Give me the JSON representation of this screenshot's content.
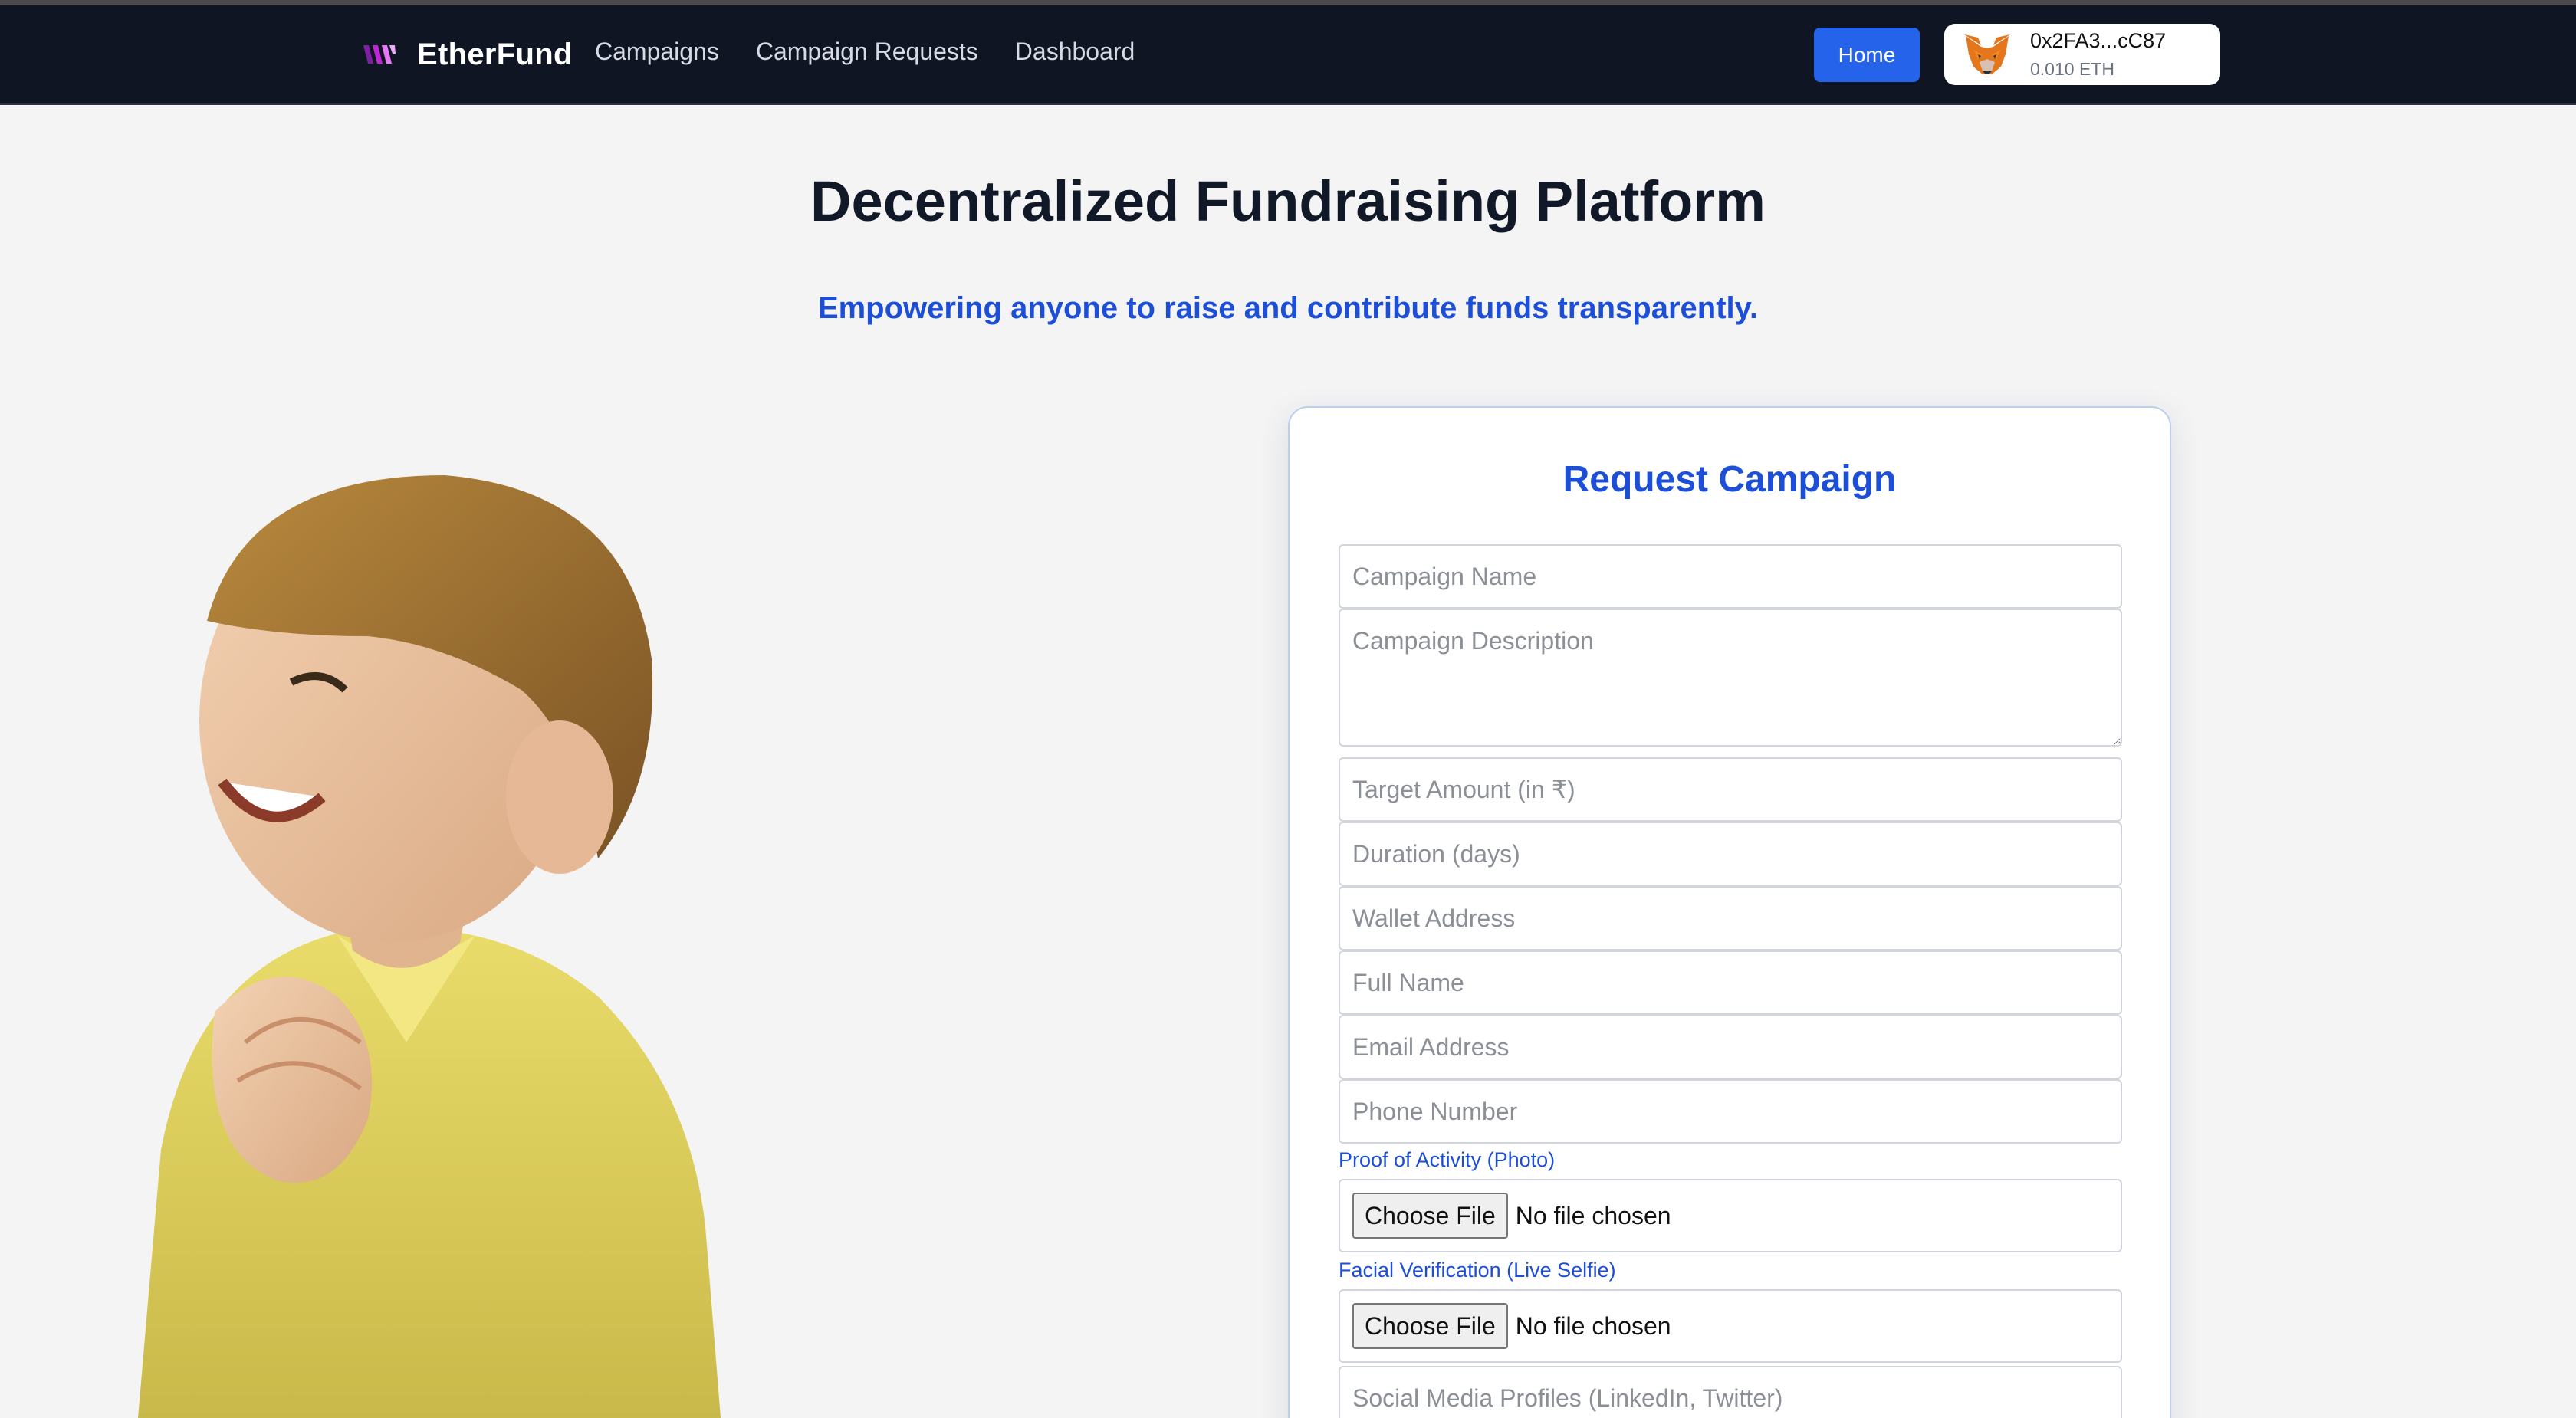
{
  "navbar": {
    "brand": "EtherFund",
    "links": [
      "Campaigns",
      "Campaign Requests",
      "Dashboard"
    ],
    "home_label": "Home",
    "wallet": {
      "address": "0x2FA3...cC87",
      "balance": "0.010 ETH"
    }
  },
  "hero": {
    "title": "Decentralized Fundraising Platform",
    "subtitle": "Empowering anyone to raise and contribute funds transparently."
  },
  "form": {
    "title": "Request Campaign",
    "placeholders": {
      "campaign_name": "Campaign Name",
      "campaign_description": "Campaign Description",
      "target_amount": "Target Amount (in ₹)",
      "duration": "Duration (days)",
      "wallet_address": "Wallet Address",
      "full_name": "Full Name",
      "email": "Email Address",
      "phone": "Phone Number",
      "social": "Social Media Profiles (LinkedIn, Twitter)"
    },
    "proof_label": "Proof of Activity (Photo)",
    "selfie_label": "Facial Verification (Live Selfie)",
    "choose_file": "Choose File",
    "no_file": "No file chosen"
  },
  "colors": {
    "navbar_bg": "#0f1523",
    "accent": "#1d4ed8",
    "button": "#2563eb",
    "page_bg": "#f4f4f4"
  },
  "icons": [
    "etherfund-logo-icon",
    "metamask-fox-icon"
  ]
}
